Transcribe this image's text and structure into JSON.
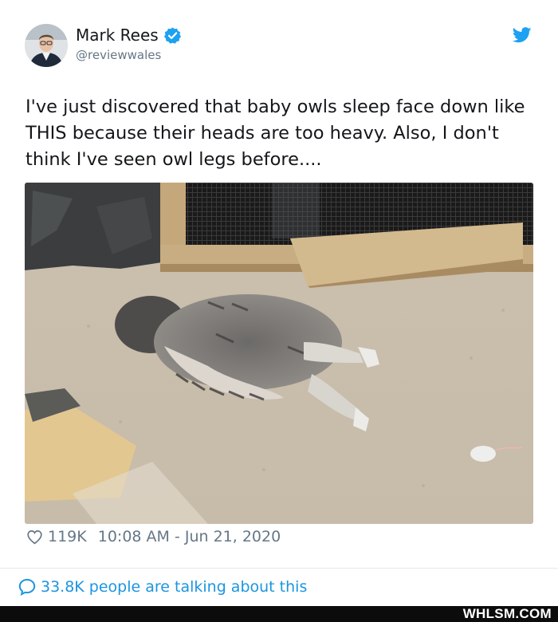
{
  "author": {
    "name": "Mark Rees",
    "handle": "@reviewwales",
    "verified": true
  },
  "tweet": {
    "text": "I've just discovered that baby owls sleep face down like THIS because their heads are too heavy. Also, I don't think I've seen owl legs before....",
    "likes": "119K",
    "timestamp": "10:08 AM - Jun 21, 2020"
  },
  "engagement": {
    "talking_label": "33.8K people are talking about this"
  },
  "footer": {
    "brand": "WHLSM.COM"
  },
  "icons": {
    "verified": "verified-badge-icon",
    "logo": "twitter-bird-icon",
    "like": "heart-icon",
    "talk": "speech-bubble-icon"
  },
  "colors": {
    "twitter_blue": "#1da1f2",
    "link_blue": "#1b95e0",
    "meta_gray": "#657786",
    "footer_bg": "#0c0c0c"
  }
}
